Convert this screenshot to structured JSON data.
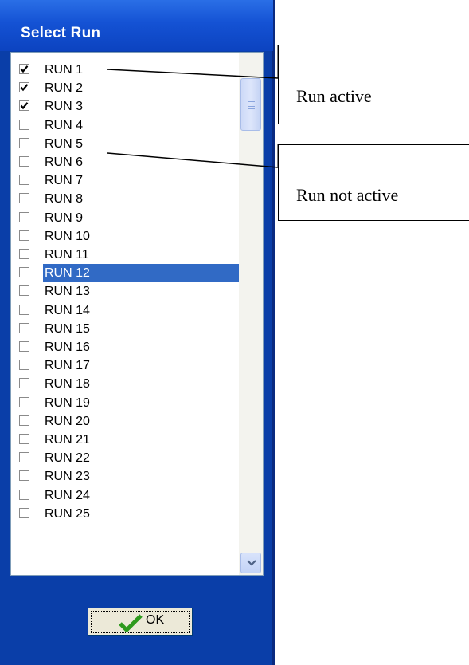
{
  "dialog": {
    "title": "Select Run",
    "runs": [
      {
        "label": "RUN 1",
        "checked": true
      },
      {
        "label": "RUN 2",
        "checked": true
      },
      {
        "label": "RUN 3",
        "checked": true
      },
      {
        "label": "RUN 4",
        "checked": false
      },
      {
        "label": "RUN 5",
        "checked": false
      },
      {
        "label": "RUN 6",
        "checked": false
      },
      {
        "label": "RUN 7",
        "checked": false
      },
      {
        "label": "RUN 8",
        "checked": false
      },
      {
        "label": "RUN 9",
        "checked": false
      },
      {
        "label": "RUN 10",
        "checked": false
      },
      {
        "label": "RUN 11",
        "checked": false
      },
      {
        "label": "RUN 12",
        "checked": false,
        "selected": true
      },
      {
        "label": "RUN 13",
        "checked": false
      },
      {
        "label": "RUN 14",
        "checked": false
      },
      {
        "label": "RUN 15",
        "checked": false
      },
      {
        "label": "RUN 16",
        "checked": false
      },
      {
        "label": "RUN 17",
        "checked": false
      },
      {
        "label": "RUN 18",
        "checked": false
      },
      {
        "label": "RUN 19",
        "checked": false
      },
      {
        "label": "RUN 20",
        "checked": false
      },
      {
        "label": "RUN 21",
        "checked": false
      },
      {
        "label": "RUN 22",
        "checked": false
      },
      {
        "label": "RUN 23",
        "checked": false
      },
      {
        "label": "RUN 24",
        "checked": false
      },
      {
        "label": "RUN 25",
        "checked": false
      }
    ],
    "ok_label": "OK"
  },
  "callouts": {
    "active": "Run active",
    "not_active": "Run not active"
  },
  "colors": {
    "dialog_bg": "#0a3ea8",
    "selection": "#316ac5",
    "check_green": "#2e9a1e"
  }
}
